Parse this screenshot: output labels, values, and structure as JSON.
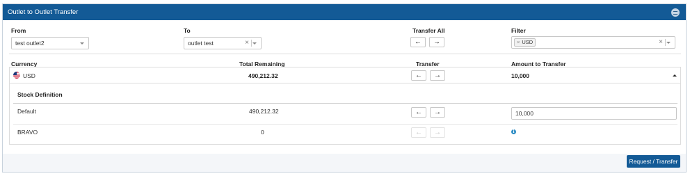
{
  "panel": {
    "title": "Outlet to Outlet Transfer"
  },
  "form": {
    "from_label": "From",
    "from_value": "test outlet2",
    "to_label": "To",
    "to_value": "outlet test",
    "transfer_all_label": "Transfer All",
    "filter_label": "Filter",
    "filter_tags": [
      "USD"
    ],
    "clear_glyph": "×",
    "left_arrow": "←",
    "right_arrow": "→"
  },
  "table": {
    "headers": {
      "currency": "Currency",
      "total_remaining": "Total Remaining",
      "transfer": "Transfer",
      "amount_to_transfer": "Amount to Transfer"
    },
    "currency_row": {
      "currency": "USD",
      "total_remaining": "490,212.32",
      "amount_to_transfer": "10,000"
    },
    "stock_definition_header": "Stock Definition",
    "stock_rows": [
      {
        "name": "Default",
        "total_remaining": "490,212.32",
        "amount": "10,000"
      },
      {
        "name": "BRAVO",
        "total_remaining": "0",
        "info_glyph": "i"
      }
    ]
  },
  "footer": {
    "submit_label": "Request / Transfer"
  },
  "colors": {
    "header_bg": "#135a96",
    "primary_button": "#135a96",
    "info": "#2d8cc4"
  }
}
